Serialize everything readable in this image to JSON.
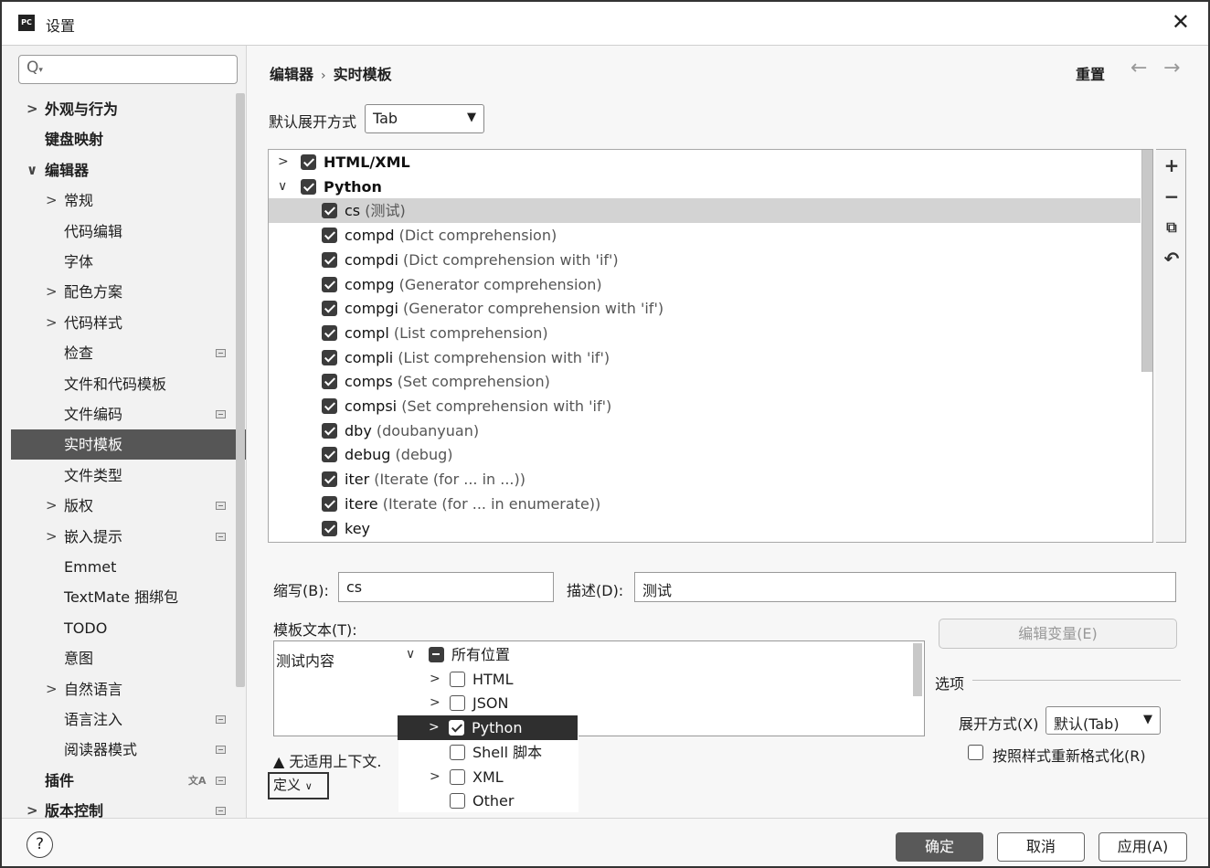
{
  "window": {
    "title": "设置",
    "app_icon_text": "PC"
  },
  "sidebar": {
    "search_placeholder": "",
    "items": [
      {
        "label": "外观与行为",
        "bold": true,
        "chevron": ">"
      },
      {
        "label": "键盘映射",
        "bold": true
      },
      {
        "label": "编辑器",
        "bold": true,
        "chevron": "∨"
      },
      {
        "label": "常规",
        "chevron": ">"
      },
      {
        "label": "代码编辑"
      },
      {
        "label": "字体"
      },
      {
        "label": "配色方案",
        "chevron": ">"
      },
      {
        "label": "代码样式",
        "chevron": ">"
      },
      {
        "label": "检查"
      },
      {
        "label": "文件和代码模板"
      },
      {
        "label": "文件编码"
      },
      {
        "label": "实时模板",
        "selected": true
      },
      {
        "label": "文件类型"
      },
      {
        "label": "版权",
        "chevron": ">"
      },
      {
        "label": "嵌入提示",
        "chevron": ">"
      },
      {
        "label": "Emmet"
      },
      {
        "label": "TextMate 捆绑包"
      },
      {
        "label": "TODO"
      },
      {
        "label": "意图"
      },
      {
        "label": "自然语言",
        "chevron": ">"
      },
      {
        "label": "语言注入"
      },
      {
        "label": "阅读器模式"
      },
      {
        "label": "插件",
        "bold": true
      },
      {
        "label": "版本控制",
        "bold": true,
        "chevron": ">"
      }
    ]
  },
  "header": {
    "breadcrumb": [
      "编辑器",
      "实时模板"
    ],
    "separator": "›",
    "reset": "重置",
    "back": "←",
    "forward": "→"
  },
  "expand_setting": {
    "label": "默认展开方式",
    "value": "Tab"
  },
  "tree": {
    "groups": [
      {
        "name": "HTML/XML",
        "chevron": ">",
        "checked": true
      },
      {
        "name": "Python",
        "chevron": "∨",
        "checked": true
      }
    ],
    "items": [
      {
        "abbr": "cs",
        "desc": "(测试)",
        "checked": true,
        "selected": true
      },
      {
        "abbr": "compd",
        "desc": "(Dict comprehension)",
        "checked": true
      },
      {
        "abbr": "compdi",
        "desc": "(Dict comprehension with 'if')",
        "checked": true
      },
      {
        "abbr": "compg",
        "desc": "(Generator comprehension)",
        "checked": true
      },
      {
        "abbr": "compgi",
        "desc": "(Generator comprehension with 'if')",
        "checked": true
      },
      {
        "abbr": "compl",
        "desc": "(List comprehension)",
        "checked": true
      },
      {
        "abbr": "compli",
        "desc": "(List comprehension with 'if')",
        "checked": true
      },
      {
        "abbr": "comps",
        "desc": "(Set comprehension)",
        "checked": true
      },
      {
        "abbr": "compsi",
        "desc": "(Set comprehension with 'if')",
        "checked": true
      },
      {
        "abbr": "dby",
        "desc": "(doubanyuan)",
        "checked": true
      },
      {
        "abbr": "debug",
        "desc": "(debug)",
        "checked": true
      },
      {
        "abbr": "iter",
        "desc": "(Iterate (for ... in ...))",
        "checked": true
      },
      {
        "abbr": "itere",
        "desc": "(Iterate (for ... in enumerate))",
        "checked": true
      },
      {
        "abbr": "key",
        "desc": "",
        "checked": true
      }
    ],
    "toolbar": {
      "add": "+",
      "remove": "−",
      "copy": "⧉",
      "restore": "↶"
    }
  },
  "form": {
    "abbr_label": "缩写(B):",
    "abbr_value": "cs",
    "desc_label": "描述(D):",
    "desc_value": "测试",
    "template_label": "模板文本(T):",
    "template_value": "测试内容",
    "edit_vars": "编辑变量(E)",
    "options_label": "选项",
    "expand_with_label": "展开方式(X)",
    "expand_with_value": "默认(Tab)",
    "reformat_label": "按照样式重新格式化(R)",
    "reformat_checked": false,
    "warning": "无适用上下文.",
    "define": "定义"
  },
  "context_popup": {
    "items": [
      {
        "label": "所有位置",
        "chevron": "∨",
        "state": "partial"
      },
      {
        "label": "HTML",
        "chevron": ">",
        "state": "off"
      },
      {
        "label": "JSON",
        "chevron": ">",
        "state": "off"
      },
      {
        "label": "Python",
        "chevron": ">",
        "state": "on",
        "selected": true
      },
      {
        "label": "Shell 脚本",
        "chevron": "",
        "state": "off"
      },
      {
        "label": "XML",
        "chevron": ">",
        "state": "off"
      },
      {
        "label": "Other",
        "chevron": "",
        "state": "off"
      }
    ]
  },
  "footer": {
    "help": "?",
    "ok": "确定",
    "cancel": "取消",
    "apply": "应用(A)"
  },
  "colors": {
    "selection_dark": "#565656",
    "row_highlight": "#d3d3d3",
    "ok_button": "#595959"
  }
}
